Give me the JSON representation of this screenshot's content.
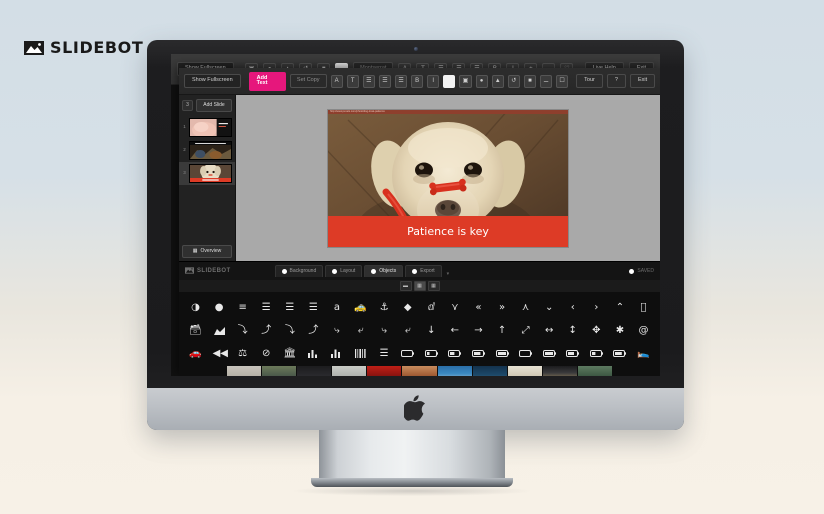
{
  "brand": {
    "name": "SLIDEBOT",
    "icon": "mountain-photo-icon"
  },
  "back_window": {
    "fullscreen_button": "Show Fullscreen",
    "font_select": "Montserrat",
    "live_help_button": "Live Help",
    "exit_button": "Exit",
    "icons": [
      "crop-icon",
      "shadow-icon",
      "opacity-icon",
      "rotate-icon",
      "layers-icon",
      "color-swatch-icon",
      "font-size-icon",
      "text-style-icon",
      "align-left-icon",
      "align-center-icon",
      "align-right-icon",
      "bold-icon",
      "italic-icon",
      "plus-icon",
      "trash-icon",
      "heart-icon"
    ]
  },
  "app": {
    "fullscreen_button": "Show Fullscreen",
    "add_text_button": "Add Text",
    "font_select_placeholder": "Set Copy",
    "tour_button": "Tour",
    "help_button": "?",
    "exit_button": "Exit",
    "toolbar_icons": [
      "font-size-icon",
      "text-style-icon",
      "align-left-icon",
      "align-center-icon",
      "align-justify-icon",
      "bold-icon",
      "italic-icon",
      "color-swatch-icon",
      "crop-icon",
      "shadow-icon",
      "opacity-icon",
      "rotate-icon",
      "layers-icon",
      "trash-icon",
      "comment-icon"
    ],
    "sidebar": {
      "slide_count_badge": "3",
      "add_slide_button": "Add Slide",
      "overview_button": "Overview",
      "overview_icon": "grid-icon",
      "slides": [
        {
          "number": "1",
          "selected": false
        },
        {
          "number": "2",
          "selected": false
        },
        {
          "number": "3",
          "selected": true
        }
      ]
    },
    "canvas": {
      "source_url": "http://www.pexels.com/photo/dog-treat-patience",
      "headline": "Patience is key",
      "banner_color": "#dd3b26",
      "image_alt": "yellow labrador with red treat balanced on nose"
    },
    "footer": {
      "logo": "SLIDEBOT",
      "tabs": [
        {
          "label": "Background",
          "active": false
        },
        {
          "label": "Layout",
          "active": false
        },
        {
          "label": "Objects",
          "active": true
        },
        {
          "label": "Export",
          "active": false
        }
      ],
      "overflow_caret": "▾",
      "saved_status": "SAVED",
      "saved_icon": "check-circle-icon"
    },
    "view_toggle": [
      {
        "icon": "list-view-icon",
        "active": false
      },
      {
        "icon": "grid-view-icon",
        "active": true
      },
      {
        "icon": "thumb-view-icon",
        "active": false
      }
    ],
    "icon_picker": {
      "rows": [
        [
          "adjust-icon",
          "adn-icon",
          "align-center-icon",
          "align-justify-icon",
          "align-left-icon",
          "align-right-icon",
          "amazon-icon",
          "ambulance-icon",
          "anchor-icon",
          "android-icon",
          "angellist-icon",
          "angle-double-down-icon",
          "angle-double-left-icon",
          "angle-double-right-icon",
          "angle-double-up-icon",
          "angle-down-icon",
          "angle-left-icon",
          "angle-right-icon",
          "angle-up-icon",
          "apple-icon"
        ],
        [
          "archive-icon",
          "area-chart-icon",
          "arrow-circle-down-icon",
          "arrow-circle-left-icon",
          "arrow-circle-o-down-icon",
          "arrow-circle-o-left-icon",
          "arrow-circle-o-right-icon",
          "arrow-circle-o-up-icon",
          "arrow-circle-right-icon",
          "arrow-circle-up-icon",
          "arrow-down-icon",
          "arrow-left-icon",
          "arrow-right-icon",
          "arrow-up-icon",
          "arrows-icon",
          "arrows-h-icon",
          "arrows-v-icon",
          "arrows-alt-icon",
          "asterisk-icon",
          "at-icon"
        ],
        [
          "automobile-icon",
          "backward-icon",
          "balance-scale-icon",
          "ban-icon",
          "bank-icon",
          "bar-chart-icon",
          "bar-chart-o-icon",
          "barcode-icon",
          "bars-icon",
          "battery-empty-icon",
          "battery-quarter-icon",
          "battery-half-icon",
          "battery-three-quarters-icon",
          "battery-full-icon",
          "battery-0-icon",
          "battery-1-icon",
          "battery-2-icon",
          "battery-3-icon",
          "battery-4-icon",
          "bed-icon"
        ]
      ]
    },
    "filmstrip": {
      "label": "image-results-strip",
      "thumb_count": 11
    }
  },
  "hardware": {
    "device": "imac-desktop",
    "apple_logo": "apple-icon",
    "webcam": "webcam-icon"
  },
  "colors": {
    "accent_pink": "#e6177c",
    "banner_red": "#dd3b26",
    "bg_top": "#d3dee6",
    "bg_bottom": "#f7f1e7"
  }
}
